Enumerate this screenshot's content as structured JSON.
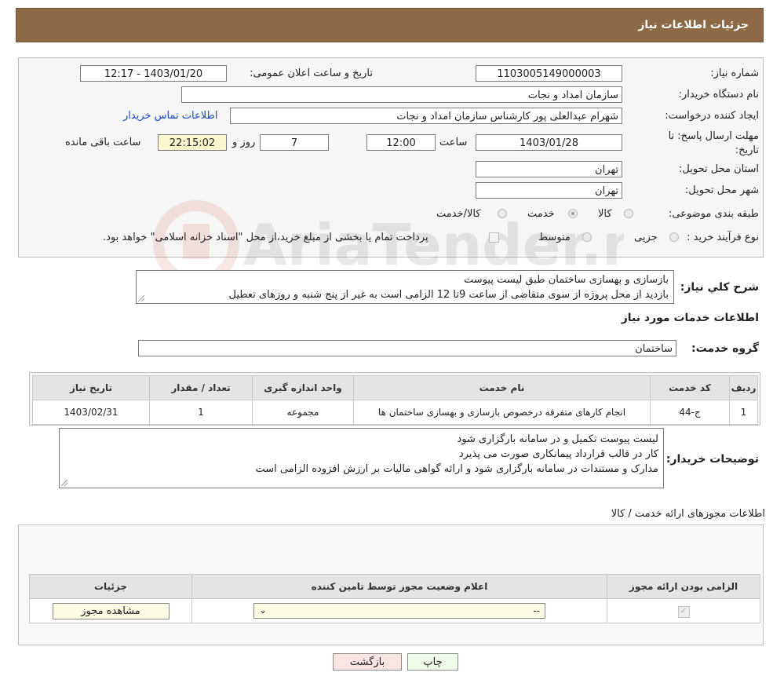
{
  "header": {
    "title": "جزئیات اطلاعات نیاز"
  },
  "form": {
    "need_number_label": "شماره نیاز:",
    "need_number": "1103005149000003",
    "announce_label": "تاریخ و ساعت اعلان عمومی:",
    "announce_value": "1403/01/20 - 12:17",
    "buyer_org_label": "نام دستگاه خریدار:",
    "buyer_org": "سازمان امداد و نجات",
    "creator_label": "ایجاد کننده درخواست:",
    "creator": "شهرام عبدالعلی پور کارشناس   سازمان امداد و نجات",
    "contact_link": "اطلاعات تماس خریدار",
    "deadline_label_1": "مهلت ارسال پاسخ: تا",
    "deadline_label_2": "تاریخ:",
    "deadline_date": "1403/01/28",
    "time_label": "ساعت",
    "deadline_time": "12:00",
    "days": "7",
    "days_label": "روز و",
    "remaining": "22:15:02",
    "remaining_label": "ساعت باقی مانده",
    "province_label": "استان محل تحویل:",
    "province": "تهران",
    "city_label": "شهر محل تحویل:",
    "city": "تهران",
    "category_label": "طبقه بندی موضوعی:",
    "category_options": [
      "کالا",
      "خدمت",
      "کالا/خدمت"
    ],
    "category_selected": "خدمت",
    "purchase_label": "نوع فرآیند خرید :",
    "purchase_options": [
      "جزیی",
      "متوسط"
    ],
    "payment_note": "پرداخت تمام یا بخشی از مبلغ خرید،از محل \"اسناد خزانه اسلامی\" خواهد بود."
  },
  "summary": {
    "label": "شرح کلي نياز:",
    "line1": "بازسازی و بهسازی ساختمان طبق لیست پیوست",
    "line2": "بازدید از محل پروژه از سوی متقاضی از ساعت 9تا 12 الزامی است به غیر از پنج شنبه و روزهای تعطیل"
  },
  "services": {
    "section_title": "اطلاعات خدمات مورد نیاز",
    "group_label": "گروه خدمت:",
    "group_value": "ساختمان",
    "columns": [
      "ردیف",
      "کد خدمت",
      "نام خدمت",
      "واحد اندازه گیری",
      "تعداد / مقدار",
      "تاریخ نیاز"
    ],
    "rows": [
      [
        "1",
        "ج-44",
        "انجام کارهای متفرقه درخصوص بازسازی و بهسازی ساختمان ها",
        "مجموعه",
        "1",
        "1403/02/31"
      ]
    ]
  },
  "buyer_notes": {
    "label": "توضیحات خریدار:",
    "lines": [
      "لیست پیوست تکمیل و در سامانه بارگزاری شود",
      "کار در قالب قرارداد پیمانکاری صورت می پذیرد",
      "مدارک و مستندات در سامانه بارگزاری شود و ارائه گواهی مالیات بر ارزش افزوده الزامی است"
    ]
  },
  "permits": {
    "section_title": "اطلاعات مجوزهای ارائه خدمت / کالا",
    "columns": [
      "الزامی بودن ارائه مجوز",
      "اعلام وضعیت مجوز توسط تامین کننده",
      "جزئیات"
    ],
    "select_value": "--",
    "view_button": "مشاهده مجوز"
  },
  "actions": {
    "print": "چاپ",
    "back": "بازگشت"
  },
  "watermark": "AriaTender.neT",
  "colors": {
    "header_bg": "#8b6a45",
    "link": "#1a49c9",
    "print_bg": "#eefbe6",
    "back_bg": "#fbe4e4",
    "timer_bg": "#fbf7cf"
  }
}
